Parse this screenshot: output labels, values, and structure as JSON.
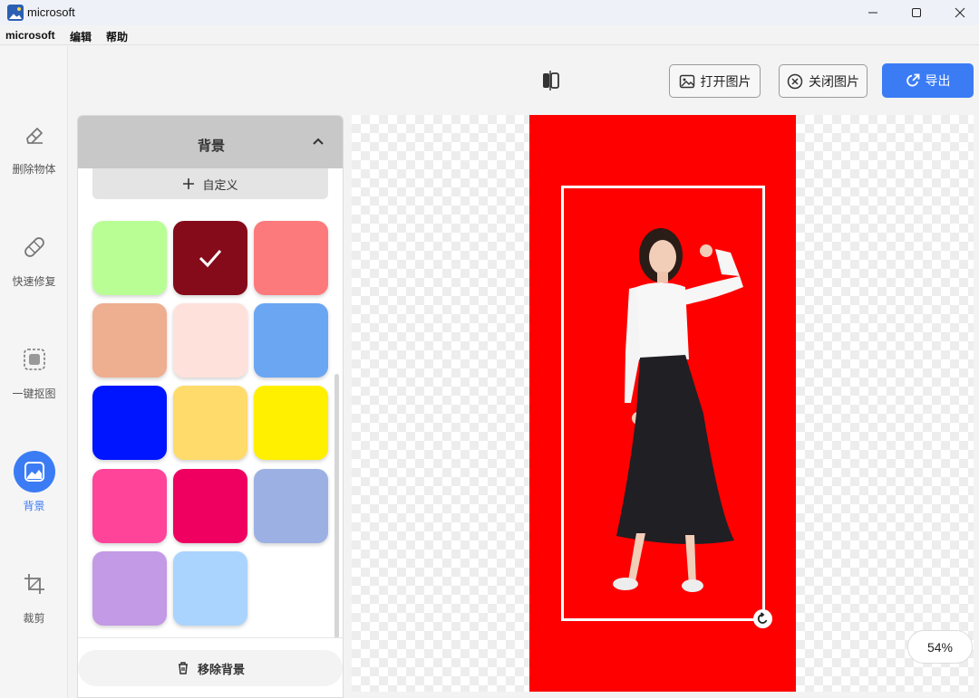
{
  "window": {
    "title": "microsoft"
  },
  "menu": {
    "items": [
      "microsoft",
      "编辑",
      "帮助"
    ]
  },
  "rail": {
    "items": [
      {
        "label": "删除物体",
        "icon": "eraser-icon"
      },
      {
        "label": "快速修复",
        "icon": "bandage-icon"
      },
      {
        "label": "一键抠图",
        "icon": "cutout-icon"
      },
      {
        "label": "背景",
        "icon": "background-image-icon",
        "active": true
      },
      {
        "label": "裁剪",
        "icon": "crop-icon"
      }
    ]
  },
  "toolbar": {
    "open_label": "打开图片",
    "close_label": "关闭图片",
    "export_label": "导出"
  },
  "panel": {
    "title": "背景",
    "custom_label": "自定义",
    "remove_label": "移除背景",
    "swatches": [
      {
        "color": "#b9fe95",
        "selected": false
      },
      {
        "color": "#850b1a",
        "selected": true
      },
      {
        "color": "#fd7a7c",
        "selected": false
      },
      {
        "color": "#eeae90",
        "selected": false
      },
      {
        "color": "#ffe1dc",
        "selected": false
      },
      {
        "color": "#6ba6f3",
        "selected": false
      },
      {
        "color": "#0015ff",
        "selected": false
      },
      {
        "color": "#fedb6b",
        "selected": false
      },
      {
        "color": "#fff000",
        "selected": false
      },
      {
        "color": "#ff4499",
        "selected": false
      },
      {
        "color": "#ef0060",
        "selected": false
      },
      {
        "color": "#9cb0e3",
        "selected": false
      },
      {
        "color": "#c39ae5",
        "selected": false
      },
      {
        "color": "#aad4fd",
        "selected": false
      }
    ]
  },
  "canvas": {
    "background_color": "#ff0000",
    "zoom_label": "54%"
  }
}
